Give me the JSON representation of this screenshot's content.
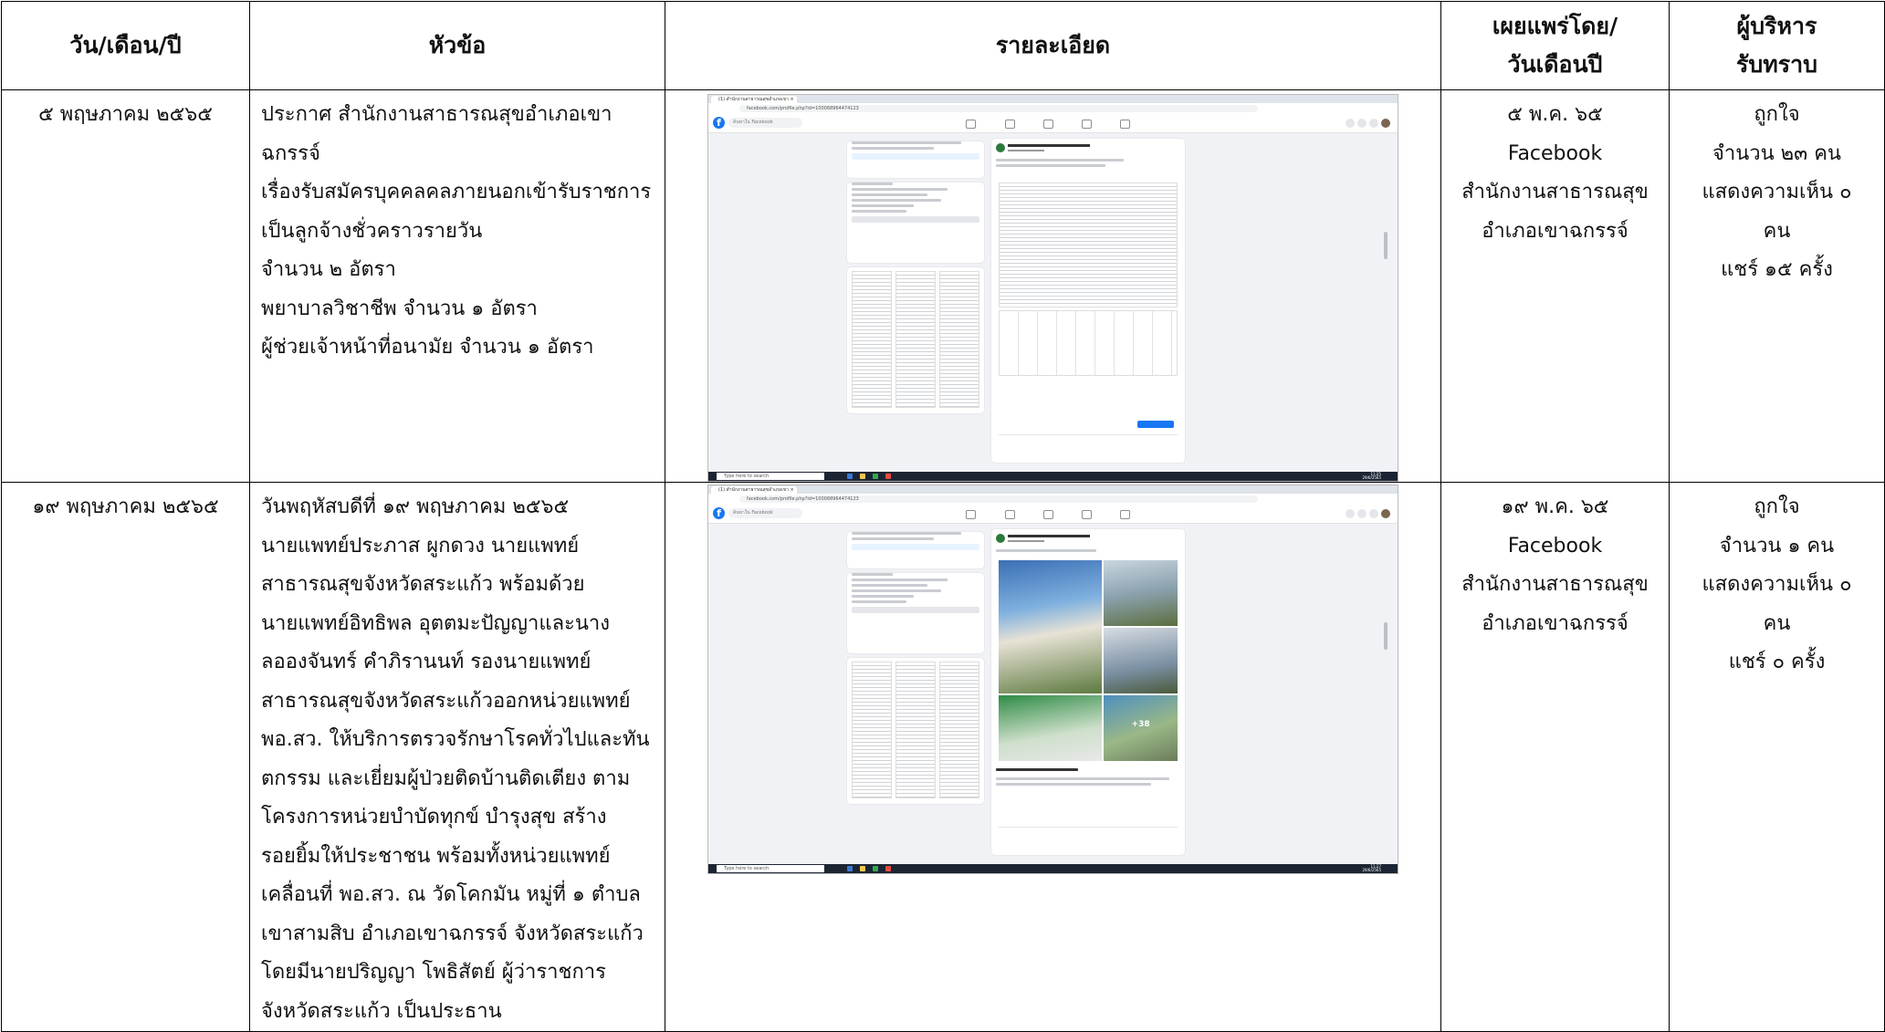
{
  "headers": {
    "date": "วัน/เดือน/ปี",
    "topic": "หัวข้อ",
    "details": "รายละเอียด",
    "published_line1": "เผยแพร่โดย/",
    "published_line2": "วันเดือนปี",
    "ack_line1": "ผู้บริหาร",
    "ack_line2": "รับทราบ"
  },
  "rows": [
    {
      "date": "๕ พฤษภาคม ๒๕๖๕",
      "topic_lines": [
        "ประกาศ สำนักงานสาธารณสุขอำเภอเขา",
        "ฉกรรจ์",
        "เรื่องรับสมัครบุคคลคลภายนอกเข้ารับราชการ",
        "เป็นลูกจ้างชั่วคราวรายวัน",
        "จำนวน ๒ อัตรา",
        "พยาบาลวิชาชีพ จำนวน ๑ อัตรา",
        "ผู้ช่วยเจ้าหน้าที่อนามัย จำนวน ๑ อัตรา"
      ],
      "screenshot": {
        "tab": "(1) สำนักงานสาธารณสุขอำเภอเขา ×",
        "url": "facebook.com/profile.php?id=100068964474123",
        "search": "ค้นหาใน Facebook",
        "taskbar_search": "Type here to search",
        "time": "11:25",
        "date": "29/6/2565"
      },
      "published_lines": [
        "๕ พ.ค. ๖๕",
        "Facebook",
        "สำนักงานสาธารณสุข",
        "อำเภอเขาฉกรรจ์"
      ],
      "ack_lines": [
        "ถูกใจ",
        "จำนวน ๒๓ คน",
        "แสดงความเห็น ๐",
        "คน",
        "แชร์ ๑๕ ครั้ง"
      ]
    },
    {
      "date": "๑๙ พฤษภาคม ๒๕๖๕",
      "topic_lines": [
        "วันพฤหัสบดีที่ ๑๙ พฤษภาคม ๒๕๖๕",
        "นายแพทย์ประภาส ผูกดวง นายแพทย์",
        "สาธารณสุขจังหวัดสระแก้ว พร้อมด้วย",
        "นายแพทย์อิทธิพล อุตตมะปัญญาและนาง",
        "ลอองจันทร์ คำภิรานนท์ รองนายแพทย์",
        "สาธารณสุขจังหวัดสระแก้วออกหน่วยแพทย์",
        "พอ.สว. ให้บริการตรวจรักษาโรคทั่วไปและทัน",
        "ตกรรม และเยี่ยมผู้ป่วยติดบ้านติดเตียง ตาม",
        "โครงการหน่วยบำบัดทุกข์ บำรุงสุข สร้าง",
        "รอยยิ้มให้ประชาชน พร้อมทั้งหน่วยแพทย์",
        "เคลื่อนที่ พอ.สว. ณ วัดโคกมัน หมู่ที่ ๑ ตำบล",
        "เขาสามสิบ อำเภอเขาฉกรรจ์ จังหวัดสระแก้ว",
        "โดยมีนายปริญญา โพธิสัตย์ ผู้ว่าราชการ",
        "จังหวัดสระแก้ว เป็นประธาน"
      ],
      "screenshot": {
        "tab": "(1) สำนักงานสาธารณสุขอำเภอเขา ×",
        "url": "facebook.com/profile.php?id=100068964474123",
        "search": "ค้นหาใน Facebook",
        "taskbar_search": "Type here to search",
        "time": "11:27",
        "date": "29/6/2565",
        "photo_counter": "+38"
      },
      "published_lines": [
        "๑๙ พ.ค. ๖๕",
        "Facebook",
        "สำนักงานสาธารณสุข",
        "อำเภอเขาฉกรรจ์"
      ],
      "ack_lines": [
        "ถูกใจ",
        "จำนวน ๑ คน",
        "แสดงความเห็น ๐",
        "คน",
        "แชร์ ๐ ครั้ง"
      ]
    }
  ]
}
